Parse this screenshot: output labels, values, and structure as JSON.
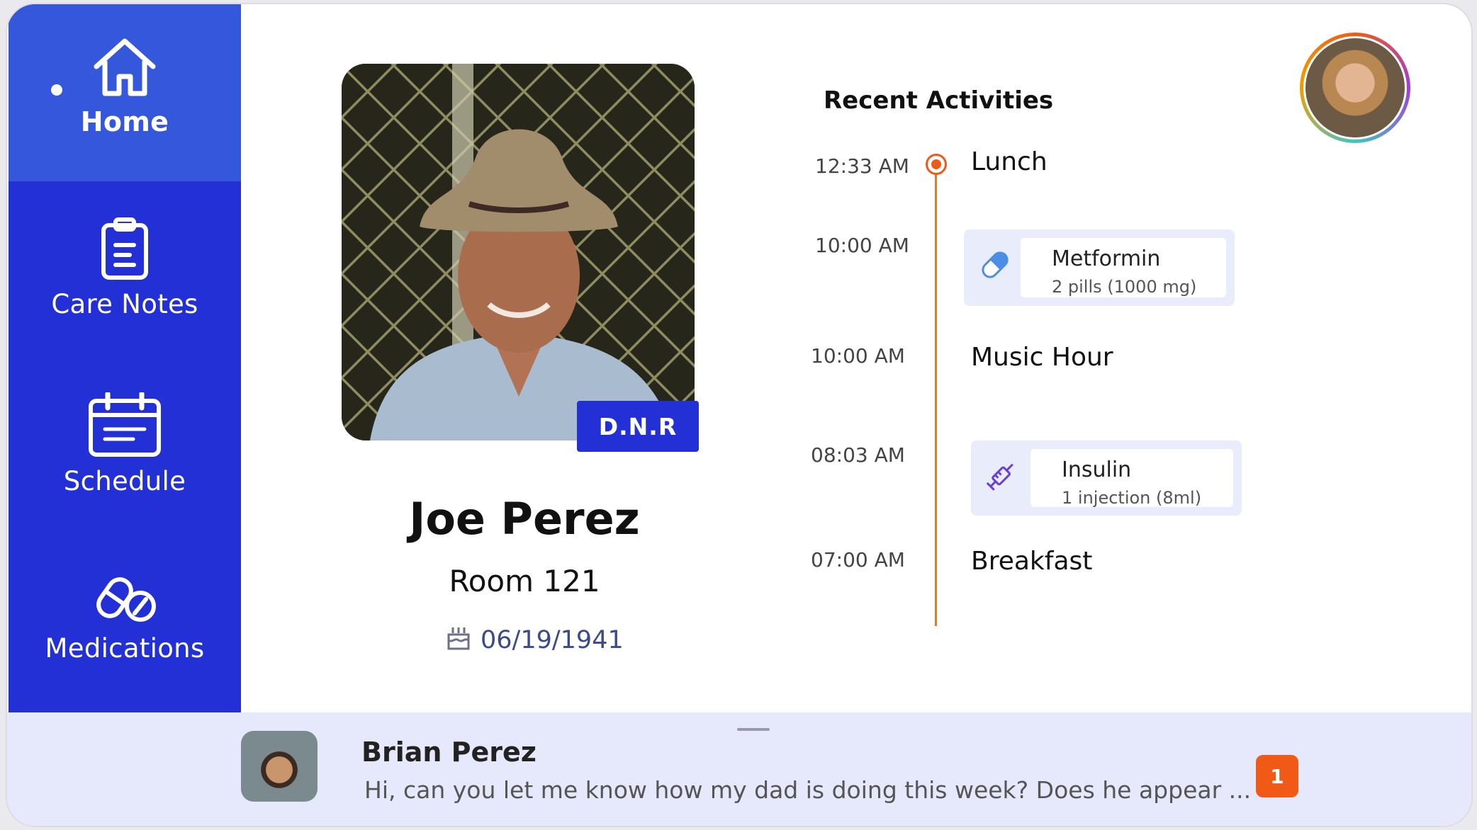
{
  "nav": {
    "items": [
      {
        "label": "Home",
        "icon": "home-icon",
        "active": true
      },
      {
        "label": "Care Notes",
        "icon": "clipboard-icon",
        "active": false
      },
      {
        "label": "Schedule",
        "icon": "calendar-icon",
        "active": false
      },
      {
        "label": "Medications",
        "icon": "pills-icon",
        "active": false
      }
    ]
  },
  "resident": {
    "badge": "D.N.R",
    "name": "Joe Perez",
    "room": "Room 121",
    "dob": "06/19/1941"
  },
  "activities": {
    "title": "Recent Activities",
    "items": [
      {
        "time": "12:33 AM",
        "title": "Lunch"
      },
      {
        "time": "10:00 AM",
        "title": "Metformin",
        "detail": "2 pills (1000 mg)",
        "icon": "pill-icon"
      },
      {
        "time": "10:00 AM",
        "title": "Music Hour"
      },
      {
        "time": "08:03 AM",
        "title": "Insulin",
        "detail": "1 injection (8ml)",
        "icon": "syringe-icon"
      },
      {
        "time": "07:00 AM",
        "title": "Breakfast"
      }
    ]
  },
  "message": {
    "sender": "Brian Perez",
    "preview": "Hi, can you let me know how my dad is doing this week? Does he appear ...",
    "unread": "1"
  },
  "colors": {
    "sidebar": "#2230d6",
    "active_nav": "#3457db",
    "accent_orange": "#f05a16",
    "message_bar": "#e6e8fb"
  }
}
